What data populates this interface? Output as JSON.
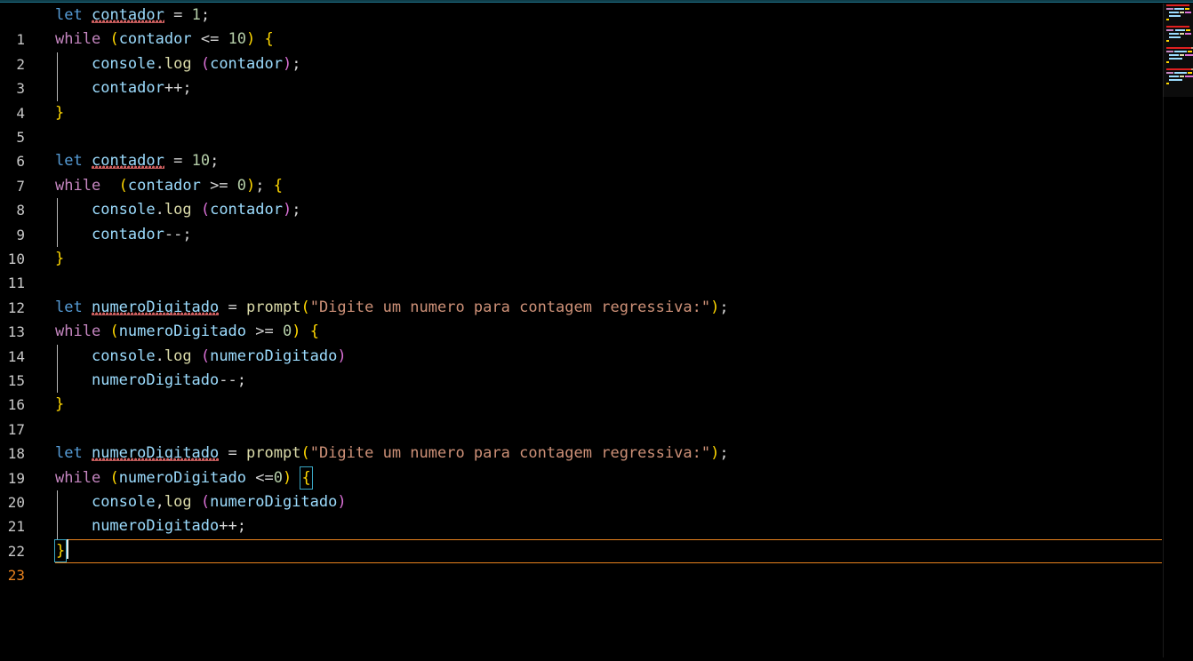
{
  "editor": {
    "language": "javascript",
    "theme": "dark-plus-black",
    "active_line": 23,
    "cursor": {
      "line": 23,
      "column": 2
    },
    "total_lines": 23,
    "colors": {
      "background": "#000000",
      "foreground": "#d4d4d4",
      "line_number": "#c8c8c8",
      "line_number_active": "#e8821e",
      "current_line_border": "#e8821e",
      "bracket_match_border": "#3aa7c4",
      "error_squiggly": "#d16060",
      "keyword_declaration": "#569cd6",
      "keyword_control": "#c586c0",
      "variable": "#9cdcfe",
      "number": "#b5cea8",
      "function": "#dcdcaa",
      "string": "#ce9178",
      "bracket_level_1": "#ffd700",
      "bracket_level_2": "#da70d6",
      "indent_guide": "#b8b8b8",
      "top_accent": "#1d6e84",
      "cursor": "#e8e8e8"
    },
    "strings": {
      "prompt_message": "Digite um numero para contagem regressiva:"
    },
    "identifiers": {
      "counter": "contador",
      "typed_number": "numeroDigitado"
    },
    "lines": [
      {
        "number": "1",
        "text": "let contador = 1;"
      },
      {
        "number": "2",
        "text": "while (contador <= 10) {"
      },
      {
        "number": "3",
        "text": "    console.log (contador);"
      },
      {
        "number": "4",
        "text": "    contador++;"
      },
      {
        "number": "5",
        "text": "}"
      },
      {
        "number": "6",
        "text": ""
      },
      {
        "number": "7",
        "text": "let contador = 10;"
      },
      {
        "number": "8",
        "text": "while  (contador >= 0); {"
      },
      {
        "number": "9",
        "text": "    console.log (contador);"
      },
      {
        "number": "10",
        "text": "    contador--;"
      },
      {
        "number": "11",
        "text": "}"
      },
      {
        "number": "12",
        "text": ""
      },
      {
        "number": "13",
        "text": "let numeroDigitado = prompt(\"Digite um numero para contagem regressiva:\");"
      },
      {
        "number": "14",
        "text": "while (numeroDigitado >= 0) {"
      },
      {
        "number": "15",
        "text": "    console.log (numeroDigitado)"
      },
      {
        "number": "16",
        "text": "    numeroDigitado--;"
      },
      {
        "number": "17",
        "text": "}"
      },
      {
        "number": "18",
        "text": ""
      },
      {
        "number": "19",
        "text": "let numeroDigitado = prompt(\"Digite um numero para contagem regressiva:\");"
      },
      {
        "number": "20",
        "text": "while (numeroDigitado <=0) {"
      },
      {
        "number": "21",
        "text": "    console,log (numeroDigitado)"
      },
      {
        "number": "22",
        "text": "    numeroDigitado++;"
      },
      {
        "number": "23",
        "text": "}"
      }
    ],
    "diagnostics": [
      {
        "line": "1",
        "token": "contador",
        "severity": "error"
      },
      {
        "line": "7",
        "token": "contador",
        "severity": "error"
      },
      {
        "line": "13",
        "token": "numeroDigitado",
        "severity": "error"
      },
      {
        "line": "19",
        "token": "numeroDigitado",
        "severity": "error"
      }
    ],
    "bracket_matches": [
      {
        "line": "20",
        "char": "{"
      },
      {
        "line": "23",
        "char": "}"
      }
    ],
    "minimap": {
      "visible": true,
      "error_marker_lines": [
        "1",
        "7",
        "13",
        "19"
      ]
    }
  }
}
